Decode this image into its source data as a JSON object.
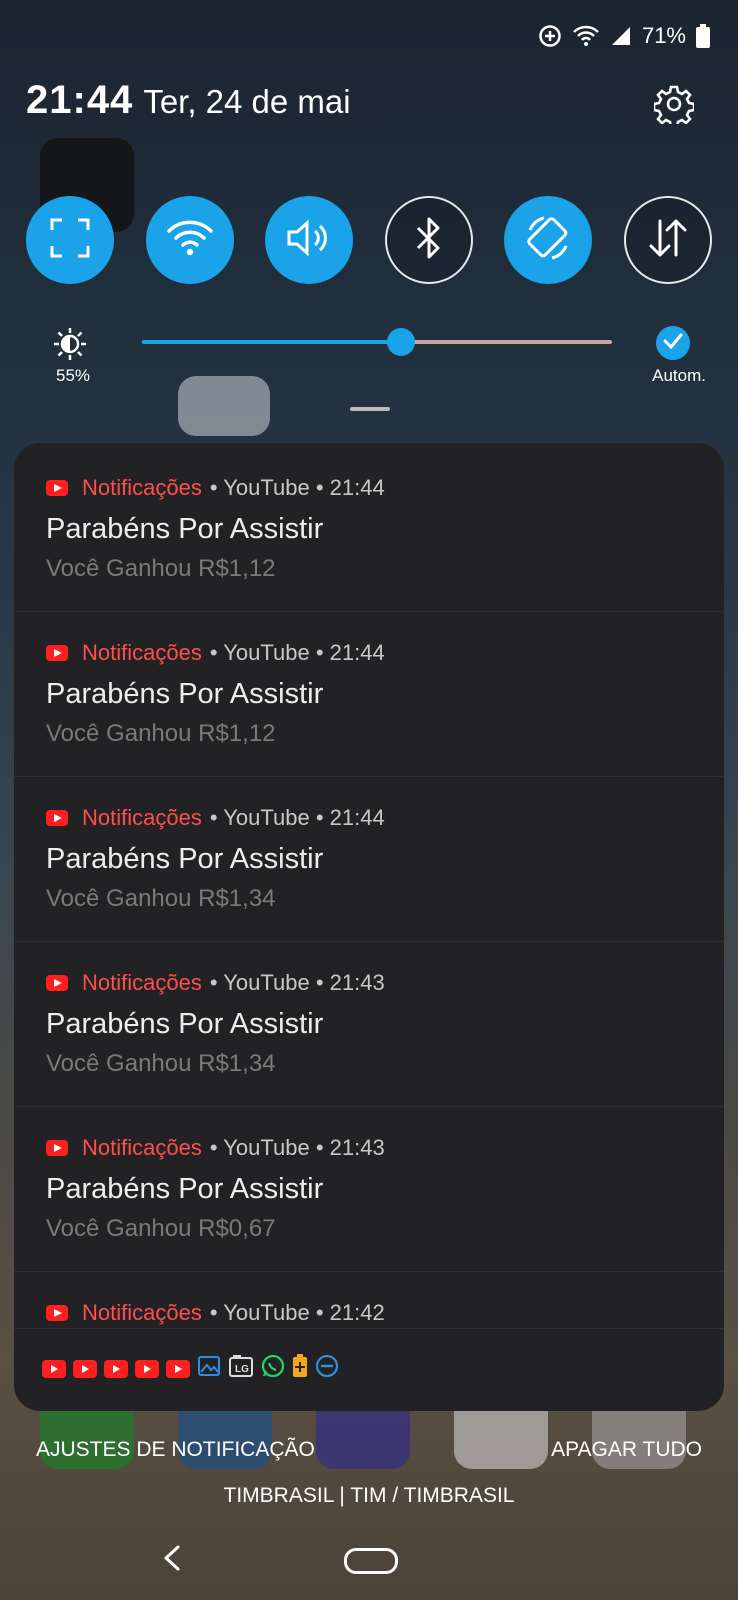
{
  "status_bar": {
    "battery_text": "71%",
    "icons": [
      "data-saver-icon",
      "wifi-icon",
      "signal-icon",
      "battery-icon"
    ]
  },
  "header": {
    "time": "21:44",
    "date": "Ter, 24 de mai"
  },
  "quick_tiles": [
    {
      "name": "screenshot-tile",
      "icon": "screenshot-frame-icon",
      "state": "on"
    },
    {
      "name": "wifi-tile",
      "icon": "wifi-icon",
      "state": "on"
    },
    {
      "name": "sound-tile",
      "icon": "speaker-icon",
      "state": "on"
    },
    {
      "name": "bluetooth-tile",
      "icon": "bluetooth-icon",
      "state": "off"
    },
    {
      "name": "auto-rotate-tile",
      "icon": "rotate-icon",
      "state": "on"
    },
    {
      "name": "mobile-data-tile",
      "icon": "data-arrows-icon",
      "state": "off"
    }
  ],
  "brightness": {
    "percent_label": "55%",
    "level": 0.55,
    "auto_label": "Autom."
  },
  "notifications": [
    {
      "app": "Notificações",
      "meta": "• YouTube • 21:44",
      "title": "Parabéns Por Assistir",
      "text": "Você Ganhou R$1,12"
    },
    {
      "app": "Notificações",
      "meta": "• YouTube • 21:44",
      "title": "Parabéns Por Assistir",
      "text": "Você Ganhou R$1,12"
    },
    {
      "app": "Notificações",
      "meta": "• YouTube • 21:44",
      "title": "Parabéns Por Assistir",
      "text": "Você Ganhou R$1,34"
    },
    {
      "app": "Notificações",
      "meta": "• YouTube • 21:43",
      "title": "Parabéns Por Assistir",
      "text": "Você Ganhou R$1,34"
    },
    {
      "app": "Notificações",
      "meta": "• YouTube • 21:43",
      "title": "Parabéns Por Assistir",
      "text": "Você Ganhou R$0,67"
    },
    {
      "app": "Notificações",
      "meta": "• YouTube • 21:42",
      "title": "",
      "text": ""
    }
  ],
  "overflow_icons": [
    "youtube-icon",
    "youtube-icon",
    "youtube-icon",
    "youtube-icon",
    "youtube-icon",
    "gallery-icon",
    "lg-icon",
    "whatsapp-icon",
    "battery-saver-icon",
    "dnd-icon"
  ],
  "footer": {
    "settings_label": "AJUSTES DE NOTIFICAÇÃO",
    "clear_label": "APAGAR TUDO",
    "carrier": "TIMBRASIL | TIM / TIMBRASIL"
  },
  "colors": {
    "accent": "#1aa3e8",
    "youtube_red": "#ff1f1f",
    "panel": "#222224"
  }
}
